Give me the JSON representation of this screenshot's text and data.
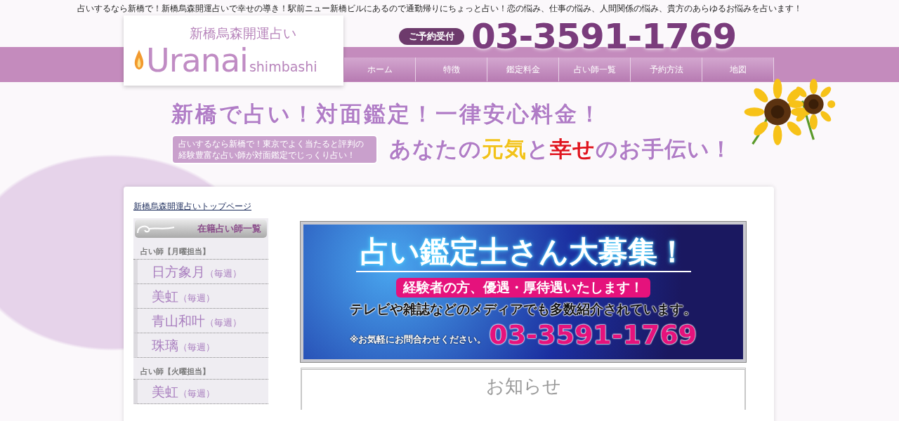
{
  "tagline": "占いするなら新橋で！新橋烏森開運占いで幸せの導き！駅前ニュー新橋ビルにあるので通勤帰りにちょっと占い！恋の悩み、仕事の悩み、人間関係の悩み、貴方のあらゆるお悩みを占います！",
  "header": {
    "logo": {
      "subtitle": "新橋烏森開運占い",
      "wordmark": "Uranai",
      "suffix": "shimbashi"
    },
    "reservation_badge": "ご予約受付",
    "phone": "03-3591-1769",
    "nav": [
      "ホーム",
      "特徴",
      "鑑定料金",
      "占い師一覧",
      "予約方法",
      "地図"
    ]
  },
  "hero": {
    "headline": "新橋で占い！対面鑑定！一律安心料金！",
    "intro": "占いするなら新橋で！東京でよく当たると評判の経験豊富な占い師が対面鑑定でじっくり占い！",
    "slogan": [
      {
        "text": "あなたの",
        "color": "#b07cc6"
      },
      {
        "text": "元気",
        "color": "#f2c21a"
      },
      {
        "text": "と",
        "color": "#b07cc6"
      },
      {
        "text": "幸せ",
        "color": "#e0141e"
      },
      {
        "text": "のお手伝い！",
        "color": "#b07cc6"
      }
    ]
  },
  "sidebar": {
    "top_link": "新橋烏森開運占いトップページ",
    "heading": "在籍占い師一覧",
    "groups": [
      {
        "label": "占い師【月曜担当】",
        "members": [
          {
            "name": "日方象月",
            "note": "（毎週）"
          },
          {
            "name": "美虹",
            "note": "（毎週）"
          },
          {
            "name": "青山和叶",
            "note": "（毎週）"
          },
          {
            "name": "珠璃",
            "note": "（毎週）"
          }
        ]
      },
      {
        "label": "占い師【火曜担当】",
        "members": [
          {
            "name": "美虹",
            "note": "（毎週）"
          }
        ]
      }
    ]
  },
  "banner": {
    "title": "占い鑑定士さん大募集！",
    "highlight": "経験者の方、優遇・厚待遇いたします！",
    "media": "テレビや雑誌などのメディアでも多数紹介されています。",
    "note": "※お気軽にお問合わせください。",
    "phone": "03-3591-1769"
  },
  "notice": {
    "heading": "お知らせ"
  }
}
